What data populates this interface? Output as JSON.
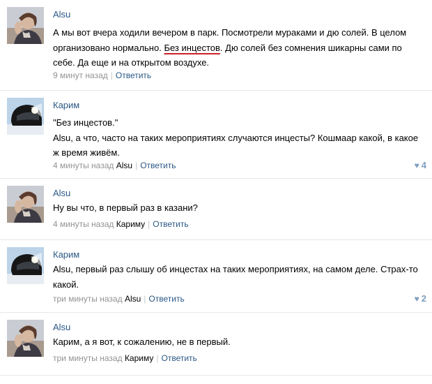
{
  "comments": [
    {
      "author": "Alsu",
      "avatar": "woman-with-hand-on-cheek-photo",
      "text_before": "А мы вот вчера ходили вечером в парк. Посмотрели мураками и дю солей. В целом организовано нормально. ",
      "text_underlined": "Без инцестов",
      "text_after": ". Дю солей без сомнения шикарны сами по себе. Да еще и на открытом воздухе.",
      "time": "9 минут назад",
      "reply_to": "",
      "reply_label": "Ответить",
      "likes": ""
    },
    {
      "author": "Карим",
      "avatar": "motorcycle-helmet-photo",
      "quote": "\"Без инцестов.\"",
      "text": "Alsu, а что, часто на таких мероприятиях случаются инцесты? Кошмаар какой, в какое ж время живём.",
      "time": "4 минуты назад",
      "reply_to": "Alsu",
      "reply_label": "Ответить",
      "likes": "4"
    },
    {
      "author": "Alsu",
      "avatar": "woman-with-hand-on-cheek-photo",
      "text": "Ну вы что, в первый раз в казани?",
      "time": "4 минуты назад",
      "reply_to": "Кариму",
      "reply_label": "Ответить",
      "likes": ""
    },
    {
      "author": "Карим",
      "avatar": "motorcycle-helmet-photo",
      "text": "Alsu, первый раз слышу об инцестах на таких мероприятиях, на самом деле. Страх-то какой.",
      "time": "три минуты назад",
      "reply_to": "Alsu",
      "reply_label": "Ответить",
      "likes": "2"
    },
    {
      "author": "Alsu",
      "avatar": "woman-with-hand-on-cheek-photo",
      "text": "Карим, а я вот, к сожалению, не в первый.",
      "time": "три минуты назад",
      "reply_to": "Кариму",
      "reply_label": "Ответить",
      "likes": ""
    }
  ],
  "colors": {
    "link": "#2a5885",
    "meta": "#939393",
    "underline": "#d0202a",
    "divider": "#e7e8ec",
    "like": "#7d9ec0"
  },
  "icons": {
    "like": "heart-icon"
  }
}
